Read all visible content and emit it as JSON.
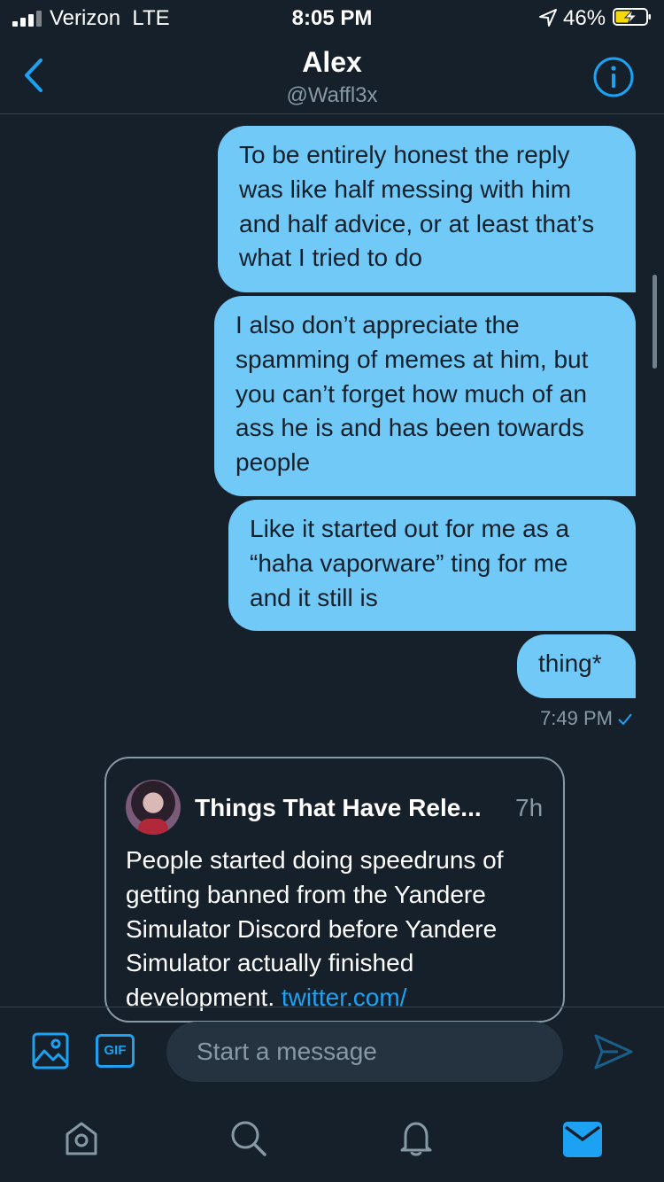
{
  "status_bar": {
    "carrier": "Verizon",
    "network": "LTE",
    "time": "8:05 PM",
    "battery": "46%",
    "icons": [
      "signal-icon",
      "location-icon",
      "battery-charging-icon"
    ]
  },
  "header": {
    "name": "Alex",
    "handle": "@Waffl3x",
    "icons": [
      "back-chevron-icon",
      "info-icon"
    ]
  },
  "messages": [
    {
      "text": "To be entirely honest the reply was like half messing with him and half advice, or at least that’s what I tried to do"
    },
    {
      "text": "I also don’t appreciate the spamming of memes at him, but you can’t forget how much of an ass he is and has been towards people"
    },
    {
      "text": "Like it started out for me as a “haha vaporware” ting for me and it still is"
    },
    {
      "text": "thing*"
    }
  ],
  "message_time": "7:49 PM",
  "shared_tweet": {
    "author": "Things That Have Rele...",
    "age": "7h",
    "text": "People started doing speedruns of getting banned from the Yandere Simulator Discord before Yandere Simulator actually finished development.",
    "link": "twitter.com/"
  },
  "composer": {
    "placeholder": "Start a message",
    "gif_label": "GIF",
    "icons": [
      "image-icon",
      "gif-icon",
      "send-icon"
    ]
  },
  "tab_bar": {
    "icons": [
      "home-icon",
      "search-icon",
      "notifications-icon",
      "messages-icon"
    ],
    "active": "messages-icon"
  },
  "colors": {
    "background": "#15202b",
    "bubble": "#71c9f8",
    "accent": "#1da1f2",
    "muted": "#8899a6"
  }
}
